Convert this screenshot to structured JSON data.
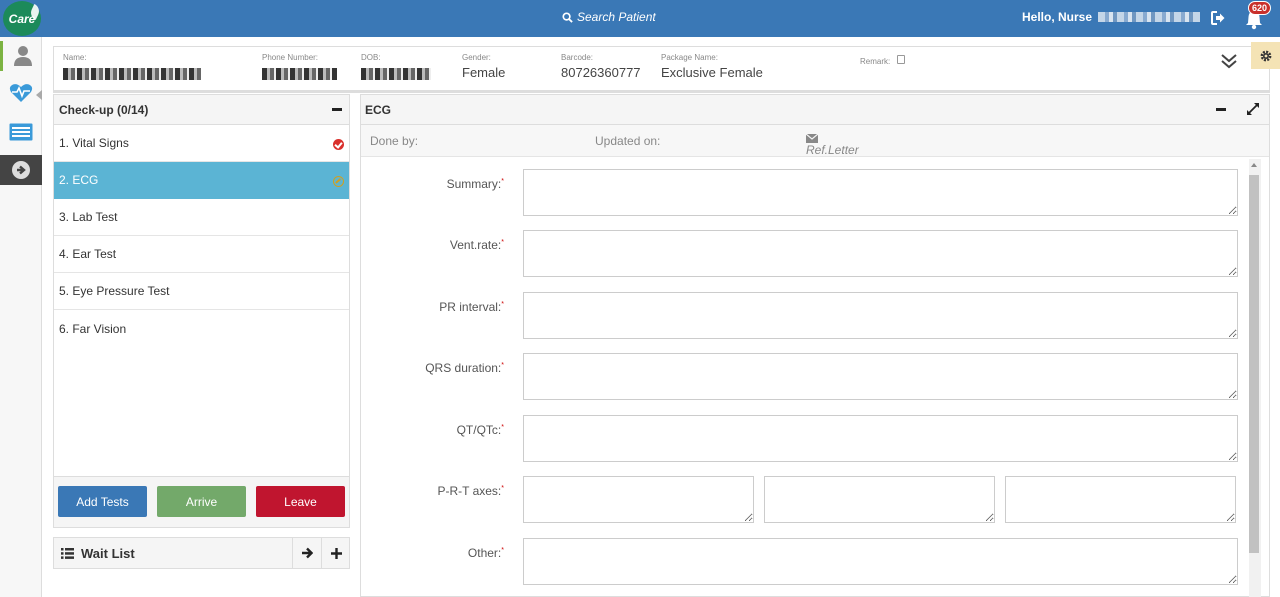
{
  "app": {
    "logo_text": "Care"
  },
  "topbar": {
    "search_label": "Search Patient",
    "greeting": "Hello, Nurse",
    "notification_count": "620"
  },
  "rail": {
    "items": [
      "patient-icon",
      "heartbeat-icon",
      "list-icon",
      "arrow-circle-icon"
    ]
  },
  "patient": {
    "name_label": "Name:",
    "phone_label": "Phone Number:",
    "dob_label": "DOB:",
    "gender_label": "Gender:",
    "gender": "Female",
    "barcode_label": "Barcode:",
    "barcode": "80726360777",
    "package_label": "Package Name:",
    "package": "Exclusive Female",
    "remark_label": "Remark:"
  },
  "checkup": {
    "title": "Check-up (0/14)",
    "items": [
      {
        "label": "1. Vital Signs",
        "status": "done"
      },
      {
        "label": "2. ECG",
        "status": "pending",
        "selected": true
      },
      {
        "label": "3. Lab Test"
      },
      {
        "label": "4. Ear Test"
      },
      {
        "label": "5. Eye Pressure Test"
      },
      {
        "label": "6. Far Vision"
      }
    ],
    "buttons": {
      "add_tests": "Add Tests",
      "arrive": "Arrive",
      "leave": "Leave"
    }
  },
  "waitlist": {
    "title": "Wait List"
  },
  "ecg": {
    "title": "ECG",
    "done_by_label": "Done by:",
    "updated_on_label": "Updated on:",
    "ref_letter": "Ref.Letter",
    "fields": {
      "summary": "Summary:",
      "vent_rate": "Vent.rate:",
      "pr_interval": "PR interval:",
      "qrs_duration": "QRS duration:",
      "qt_qtc": "QT/QTc:",
      "prt_axes": "P-R-T axes:",
      "other": "Other:"
    },
    "required_mark": "*"
  },
  "colors": {
    "topbar": "#3a78b6",
    "selected_item": "#5bb4d4",
    "add_tests_button": "#3a78b6",
    "arrive_button": "#73a96a",
    "leave_button": "#c0152f",
    "notification_badge": "#c9302c"
  }
}
